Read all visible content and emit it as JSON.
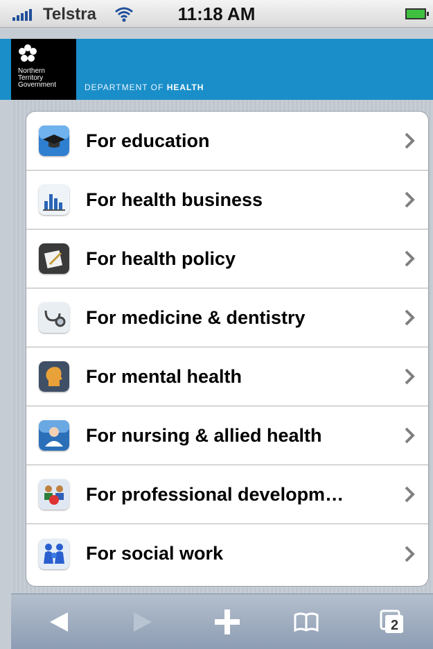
{
  "status_bar": {
    "carrier": "Telstra",
    "time": "11:18 AM"
  },
  "header": {
    "logo_lines": [
      "Northern",
      "Territory",
      "Government"
    ],
    "department_prefix": "DEPARTMENT OF",
    "department_name": "HEALTH",
    "brand_color": "#1a8ec9"
  },
  "menu": {
    "items": [
      {
        "label": "For education",
        "icon": "graduation-cap-icon"
      },
      {
        "label": "For health business",
        "icon": "bar-chart-icon"
      },
      {
        "label": "For health policy",
        "icon": "document-pen-icon"
      },
      {
        "label": "For medicine & dentistry",
        "icon": "stethoscope-icon"
      },
      {
        "label": "For mental health",
        "icon": "head-profile-icon"
      },
      {
        "label": "For nursing & allied health",
        "icon": "nurse-icon"
      },
      {
        "label": "For professional developm…",
        "icon": "group-meeting-icon"
      },
      {
        "label": "For social work",
        "icon": "family-icon"
      }
    ]
  },
  "toolbar": {
    "tabs_count": "2",
    "buttons": [
      "back-icon",
      "forward-icon",
      "add-icon",
      "bookmarks-icon",
      "tabs-icon"
    ]
  }
}
